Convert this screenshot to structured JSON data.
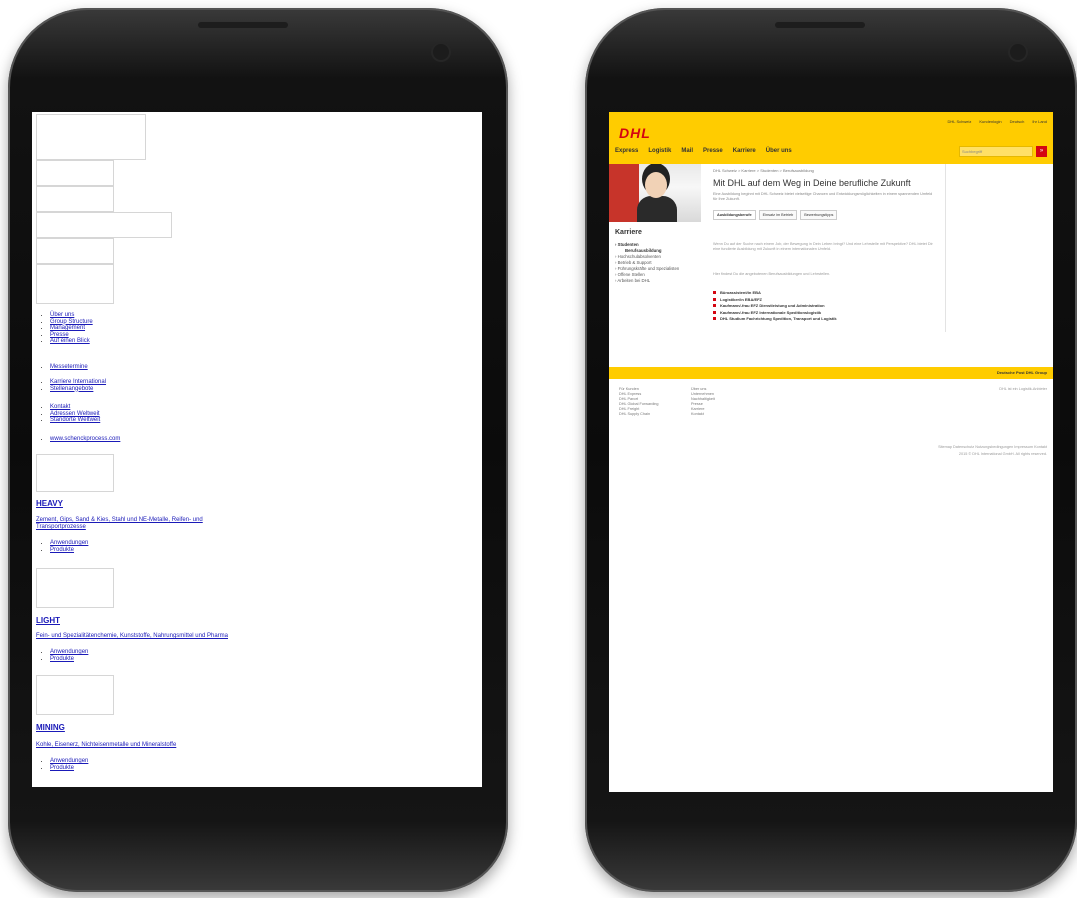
{
  "left_page": {
    "links_group1": [
      "Über uns",
      "Group Structure",
      "Management",
      "Presse",
      "Auf einen Blick"
    ],
    "links_group2": [
      "Messetermine"
    ],
    "links_group3": [
      "Karriere International",
      "Stellenangebote"
    ],
    "links_group4": [
      "Kontakt",
      "Adressen Weltweit",
      "Standorte Weltweit"
    ],
    "links_group5": [
      "www.schenckprocess.com"
    ],
    "sections": [
      {
        "title": "HEAVY",
        "description": "Zement, Gips, Sand & Kies, Stahl und NE-Metalle, Reifen- und Transportprozesse",
        "links": [
          "Anwendungen",
          "Produkte"
        ]
      },
      {
        "title": "LIGHT",
        "description": "Fein- und Spezialitätenchemie, Kunststoffe, Nahrungsmittel und Pharma",
        "links": [
          "Anwendungen",
          "Produkte"
        ]
      },
      {
        "title": "MINING",
        "description": "Kohle, Eisenerz, Nichteisenmetalle und Mineralstoffe",
        "links": [
          "Anwendungen",
          "Produkte"
        ]
      }
    ]
  },
  "right_page": {
    "logo": "DHL",
    "top_links": [
      "DHL Schweiz",
      "Kundenlogin",
      "Deutsch",
      "Ihr Land"
    ],
    "nav": [
      "Express",
      "Logistik",
      "Mail",
      "Presse",
      "Karriere",
      "Über uns"
    ],
    "search_placeholder": "Suchbegriff",
    "search_button": "»",
    "breadcrumb": "DHL Schweiz > Karriere > Studenten > Berufsausbildung",
    "title": "Mit DHL auf dem Weg in Deine berufliche Zukunft",
    "intro": "Eine Ausbildung beginnt mit DHL Schweiz bietet vielseitige Chancen und Entwicklungsmöglichkeiten in einem spannenden Umfeld für Ihre Zukunft.",
    "tabs": [
      "Ausbildungsberufe",
      "Einsatz im Betrieb",
      "Bewerbungstipps"
    ],
    "paragraph1": "Wenn Du auf der Suche nach einem Job, der Bewegung in Dein Leben bringt? Und eine Lehrstelle mit Perspektive? DHL bietet Dir eine fundierte Ausbildung mit Zukunft in einem internationalen Umfeld.",
    "paragraph2": "Hier findest Du die angebotenen Berufsausbildungen und Lehrstellen.",
    "link_list": [
      "Büroassistent/in EBA",
      "Logistiker/in EBA/EFZ",
      "Kaufmann/-frau EFZ Dienstleistung und Administration",
      "Kaufmann/-frau EFZ Internationale Speditionslogistik",
      "DHL Studium Fachrichtung Spedition, Transport und Logistik"
    ],
    "sidebar_title": "Karriere",
    "sidebar": [
      {
        "label": "Studenten",
        "type": "active"
      },
      {
        "label": "Berufsausbildung",
        "type": "sub"
      },
      {
        "label": "Hochschulabsolventen",
        "type": "item"
      },
      {
        "label": "Betrieb & Support",
        "type": "item"
      },
      {
        "label": "Führungskräfte und Spezialisten",
        "type": "item"
      },
      {
        "label": "Offene Stellen",
        "type": "item"
      },
      {
        "label": "Arbeiten bei DHL",
        "type": "item"
      }
    ],
    "footer_bar": "Deutsche Post DHL Group",
    "footer_col1": [
      "Für Kunden",
      "DHL Express",
      "DHL Parcel",
      "DHL Global Forwarding",
      "DHL Freight",
      "DHL Supply Chain"
    ],
    "footer_col2": [
      "Über uns",
      "Unternehmen",
      "Nachhaltigkeit",
      "Presse",
      "Karriere",
      "Kontakt"
    ],
    "footer_right_top": "DHL ist ein Logistik-Anbieter",
    "footer_legal": "Sitemap Datenschutz Nutzungsbedingungen Impressum Kontakt",
    "footer_copy": "2015 © DHL International GmbH. All rights reserved."
  },
  "colors": {
    "dhl_yellow": "#ffcc00",
    "dhl_red": "#d40511",
    "link_blue": "#1a1ab8",
    "phone_body": "#111111"
  }
}
